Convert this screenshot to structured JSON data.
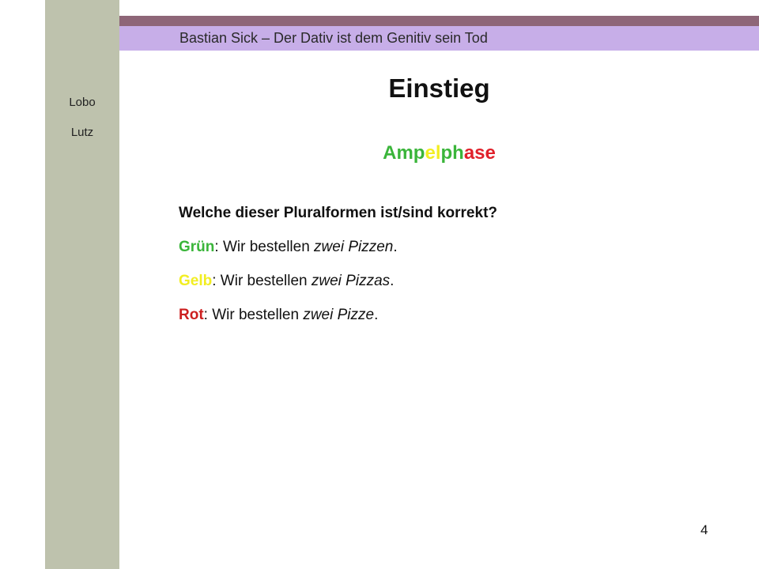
{
  "sidebar": {
    "authors": [
      "Lobo",
      "Lutz"
    ]
  },
  "header": {
    "text": "Bastian Sick – Der Dativ ist dem Genitiv sein Tod"
  },
  "slide": {
    "title": "Einstieg",
    "subtitle_parts": [
      {
        "text": "Amp",
        "color": "#3ab53a"
      },
      {
        "text": "el",
        "color": "#f2ee22"
      },
      {
        "text": "ph",
        "color": "#3ab53a"
      },
      {
        "text": "ase",
        "color": "#e0202a"
      }
    ],
    "question": "Welche dieser Pluralformen ist/sind korrekt?",
    "options": [
      {
        "label": "Grün",
        "label_color": "#3ab53a",
        "sentence": ": Wir bestellen ",
        "example": "zwei Pizzen",
        "end": "."
      },
      {
        "label": "Gelb",
        "label_color": "#f2ee22",
        "sentence": ": Wir bestellen ",
        "example": "zwei Pizzas",
        "end": "."
      },
      {
        "label": "Rot",
        "label_color": "#cc1f1f",
        "sentence": ": Wir bestellen ",
        "example": "zwei Pizze",
        "end": "."
      }
    ]
  },
  "footer": {
    "page_number": "4"
  }
}
